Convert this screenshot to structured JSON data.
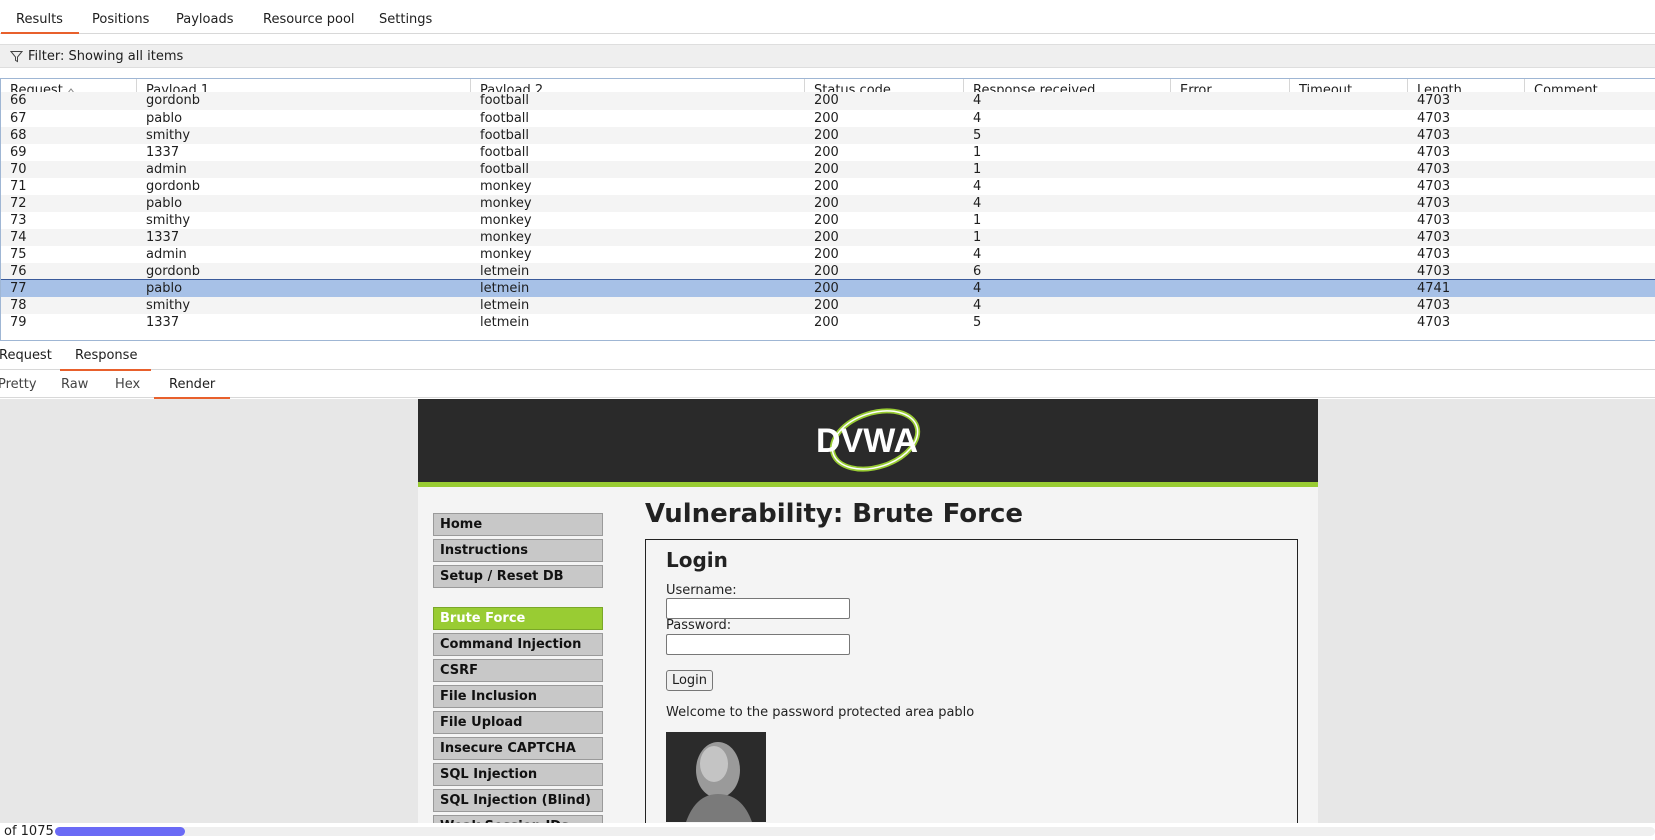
{
  "tabs": [
    {
      "label": "Results",
      "active": true
    },
    {
      "label": "Positions",
      "active": false
    },
    {
      "label": "Payloads",
      "active": false
    },
    {
      "label": "Resource pool",
      "active": false
    },
    {
      "label": "Settings",
      "active": false
    }
  ],
  "filter": {
    "label": "Filter: Showing all items"
  },
  "table": {
    "columns": [
      "Request",
      "Payload 1",
      "Payload 2",
      "Status code",
      "Response received",
      "Error",
      "Timeout",
      "Length",
      "Comment"
    ],
    "sort_column": "Request",
    "sort_direction": "ascending",
    "partial_row": {
      "request": "66",
      "payload1": "gordonb",
      "payload2": "football",
      "status": "200",
      "received": "4",
      "error": "",
      "timeout": "",
      "length": "4703",
      "comment": ""
    },
    "rows": [
      {
        "request": "67",
        "payload1": "pablo",
        "payload2": "football",
        "status": "200",
        "received": "4",
        "error": "",
        "timeout": "",
        "length": "4703",
        "comment": ""
      },
      {
        "request": "68",
        "payload1": "smithy",
        "payload2": "football",
        "status": "200",
        "received": "5",
        "error": "",
        "timeout": "",
        "length": "4703",
        "comment": ""
      },
      {
        "request": "69",
        "payload1": "1337",
        "payload2": "football",
        "status": "200",
        "received": "1",
        "error": "",
        "timeout": "",
        "length": "4703",
        "comment": ""
      },
      {
        "request": "70",
        "payload1": "admin",
        "payload2": "football",
        "status": "200",
        "received": "1",
        "error": "",
        "timeout": "",
        "length": "4703",
        "comment": ""
      },
      {
        "request": "71",
        "payload1": "gordonb",
        "payload2": "monkey",
        "status": "200",
        "received": "4",
        "error": "",
        "timeout": "",
        "length": "4703",
        "comment": ""
      },
      {
        "request": "72",
        "payload1": "pablo",
        "payload2": "monkey",
        "status": "200",
        "received": "4",
        "error": "",
        "timeout": "",
        "length": "4703",
        "comment": ""
      },
      {
        "request": "73",
        "payload1": "smithy",
        "payload2": "monkey",
        "status": "200",
        "received": "1",
        "error": "",
        "timeout": "",
        "length": "4703",
        "comment": ""
      },
      {
        "request": "74",
        "payload1": "1337",
        "payload2": "monkey",
        "status": "200",
        "received": "1",
        "error": "",
        "timeout": "",
        "length": "4703",
        "comment": ""
      },
      {
        "request": "75",
        "payload1": "admin",
        "payload2": "monkey",
        "status": "200",
        "received": "4",
        "error": "",
        "timeout": "",
        "length": "4703",
        "comment": ""
      },
      {
        "request": "76",
        "payload1": "gordonb",
        "payload2": "letmein",
        "status": "200",
        "received": "6",
        "error": "",
        "timeout": "",
        "length": "4703",
        "comment": ""
      },
      {
        "request": "77",
        "payload1": "pablo",
        "payload2": "letmein",
        "status": "200",
        "received": "4",
        "error": "",
        "timeout": "",
        "length": "4741",
        "comment": "",
        "selected": true
      },
      {
        "request": "78",
        "payload1": "smithy",
        "payload2": "letmein",
        "status": "200",
        "received": "4",
        "error": "",
        "timeout": "",
        "length": "4703",
        "comment": ""
      },
      {
        "request": "79",
        "payload1": "1337",
        "payload2": "letmein",
        "status": "200",
        "received": "5",
        "error": "",
        "timeout": "",
        "length": "4703",
        "comment": ""
      }
    ]
  },
  "message_tabs": [
    {
      "label": "Request",
      "active": false
    },
    {
      "label": "Response",
      "active": true
    }
  ],
  "view_tabs": [
    {
      "label": "Pretty",
      "active": false
    },
    {
      "label": "Raw",
      "active": false
    },
    {
      "label": "Hex",
      "active": false
    },
    {
      "label": "Render",
      "active": true
    }
  ],
  "render": {
    "logo_text": "DVWA",
    "menu": [
      {
        "label": "Home",
        "active": false
      },
      {
        "label": "Instructions",
        "active": false
      },
      {
        "label": "Setup / Reset DB",
        "active": false
      },
      {
        "label": "Brute Force",
        "active": true
      },
      {
        "label": "Command Injection",
        "active": false
      },
      {
        "label": "CSRF",
        "active": false
      },
      {
        "label": "File Inclusion",
        "active": false
      },
      {
        "label": "File Upload",
        "active": false
      },
      {
        "label": "Insecure CAPTCHA",
        "active": false
      },
      {
        "label": "SQL Injection",
        "active": false
      },
      {
        "label": "SQL Injection (Blind)",
        "active": false
      },
      {
        "label": "Weak Session IDs",
        "active": false
      }
    ],
    "page_title": "Vulnerability: Brute Force",
    "login_title": "Login",
    "username_label": "Username:",
    "password_label": "Password:",
    "username_value": "",
    "password_value": "",
    "login_button": "Login",
    "welcome_text": "Welcome to the password protected area pablo"
  },
  "status": {
    "progress_text": "of 1075",
    "progress_fraction": 0.081
  },
  "colors": {
    "accent": "#e8602c",
    "selected_row": "#a7c1e7",
    "dvwa_green": "#99cc33",
    "progress": "#6a6af5"
  }
}
